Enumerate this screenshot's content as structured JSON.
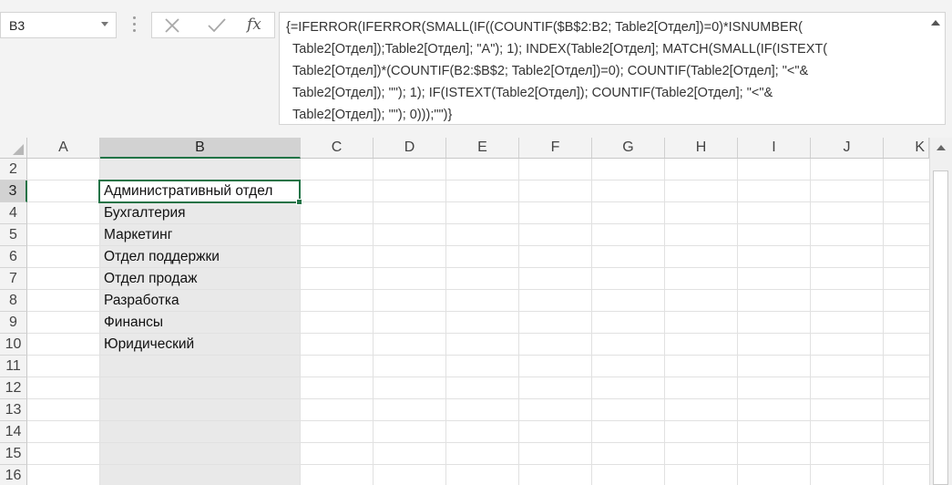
{
  "name_box": {
    "value": "B3"
  },
  "formula_bar": {
    "fx_label": "fx",
    "lines": [
      "{=IFERROR(IFERROR(SMALL(IF((COUNTIF($B$2:B2; Table2[Отдел])=0)*ISNUMBER(",
      "Table2[Отдел]);Table2[Отдел]; \"A\"); 1); INDEX(Table2[Отдел]; MATCH(SMALL(IF(ISTEXT(",
      "Table2[Отдел])*(COUNTIF(B2:$B$2; Table2[Отдел])=0); COUNTIF(Table2[Отдел]; \"<\"&",
      "Table2[Отдел]); \"\"); 1); IF(ISTEXT(Table2[Отдел]); COUNTIF(Table2[Отдел]; \"<\"&",
      "Table2[Отдел]); \"\"); 0)));\"\")}"
    ]
  },
  "columns": [
    "A",
    "B",
    "C",
    "D",
    "E",
    "F",
    "G",
    "H",
    "I",
    "J",
    "K"
  ],
  "rows": [
    "2",
    "3",
    "4",
    "5",
    "6",
    "7",
    "8",
    "9",
    "10",
    "11",
    "12",
    "13",
    "14",
    "15",
    "16"
  ],
  "column_b_values": [
    "",
    "Административный отдел",
    "Бухгалтерия",
    "Маркетинг",
    "Отдел поддержки",
    "Отдел продаж",
    "Разработка",
    "Финансы",
    "Юридический"
  ],
  "active_cell": "B3",
  "colors": {
    "accent": "#217346",
    "header_bg": "#f3f3f3",
    "selected_header_bg": "#d2d2d2"
  },
  "icons": {
    "cancel": "close-icon",
    "enter": "check-icon",
    "function": "fx-icon"
  }
}
